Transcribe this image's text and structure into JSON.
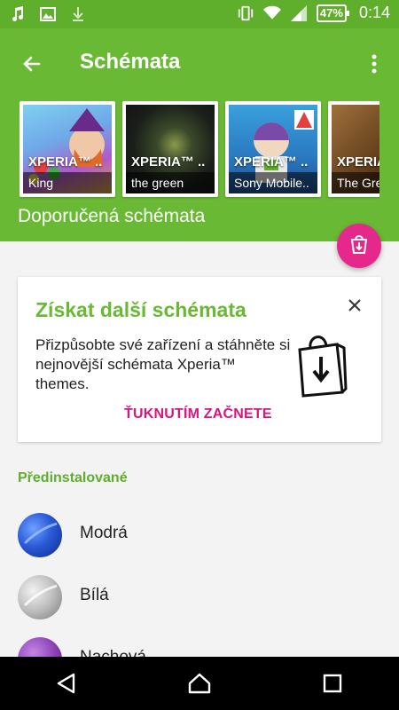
{
  "status_bar": {
    "icons": [
      "music-icon",
      "image-icon",
      "download-icon",
      "vibrate-icon",
      "wifi-icon",
      "signal-icon"
    ],
    "battery_percent": "47%",
    "time": "0:14"
  },
  "app_bar": {
    "title": "Schémata",
    "back_icon": "arrow-left-icon",
    "overflow_icon": "more-vert-icon",
    "recommended_label": "Doporučená schémata",
    "themes": [
      {
        "name": "XPERIA™ ..",
        "author": "King",
        "thumb": "bubble-witch"
      },
      {
        "name": "XPERIA™ ..",
        "author": "the green",
        "thumb": "green-planet"
      },
      {
        "name": "XPERIA™ ..",
        "author": "Sony Mobile..",
        "thumb": "toy-story"
      },
      {
        "name": "XPERIA",
        "author": "The Gre",
        "thumb": "brown"
      }
    ]
  },
  "fab": {
    "icon": "store-bag-icon"
  },
  "promo": {
    "title": "Získat další schémata",
    "body": "Přizpůsobte své zařízení a stáhněte si nejnovější schémata Xperia™ themes.",
    "action": "ŤUKNUTÍM ZAČNETE",
    "close_icon": "close-icon",
    "bag_icon": "shopping-bag-download-icon"
  },
  "preinstalled": {
    "label": "Předinstalované",
    "items": [
      {
        "label": "Modrá",
        "color": "#2a5ad8"
      },
      {
        "label": "Bílá",
        "color": "#bdbdbd"
      },
      {
        "label": "Nachová",
        "color": "#8a3fb5"
      }
    ]
  },
  "nav_bar": {
    "icons": [
      "back-icon",
      "home-icon",
      "recents-icon"
    ]
  },
  "colors": {
    "accent_green": "#6ab934",
    "status_green": "#5fae2c",
    "accent_pink": "#e4288c",
    "action_pink": "#d6157e"
  }
}
